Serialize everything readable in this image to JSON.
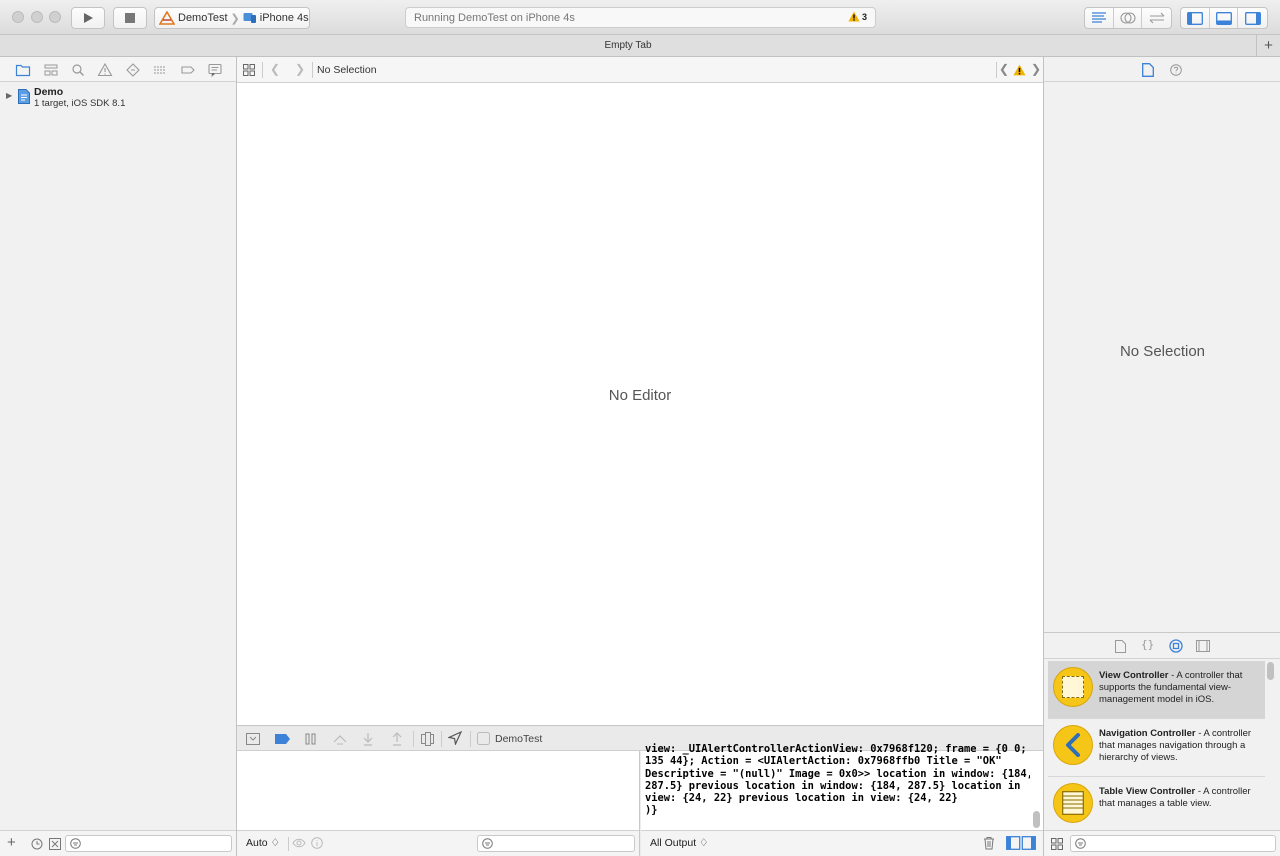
{
  "toolbar": {
    "scheme_project": "DemoTest",
    "scheme_device": "iPhone 4s",
    "activity_status": "Running DemoTest on iPhone 4s",
    "warning_count": "3"
  },
  "tab_bar": {
    "title": "Empty Tab",
    "add_label": "+"
  },
  "navigator": {
    "project_name": "Demo",
    "project_subtitle": "1 target, iOS SDK 8.1"
  },
  "editor": {
    "jump_bar_label": "No Selection",
    "placeholder": "No Editor"
  },
  "debug_bar": {
    "process_label": "DemoTest"
  },
  "variables_footer": {
    "mode_select": "Auto ♢"
  },
  "console": {
    "text": "view: _UIAlertControllerActionView: 0x7968f120; frame = {0 0;\n135 44}; Action = <UIAlertAction: 0x7968ffb0 Title = \"OK\"\nDescriptive = \"(null)\" Image = 0x0>> location in window: {184,\n287.5} previous location in window: {184, 287.5} location in\nview: {24, 22} previous location in view: {24, 22}\n)}",
    "output_select": "All Output ♢"
  },
  "inspector": {
    "placeholder": "No Selection"
  },
  "library": {
    "items": [
      {
        "title": "View Controller",
        "desc": " - A controller that supports the fundamental view-management model in iOS."
      },
      {
        "title": "Navigation Controller",
        "desc": " - A controller that manages navigation through a hierarchy of views."
      },
      {
        "title": "Table View Controller",
        "desc": " - A controller that manages a table view."
      }
    ]
  },
  "colors": {
    "accent_blue": "#3b82d8",
    "warning_yellow": "#f2b400",
    "library_icon": "#f5c518"
  }
}
